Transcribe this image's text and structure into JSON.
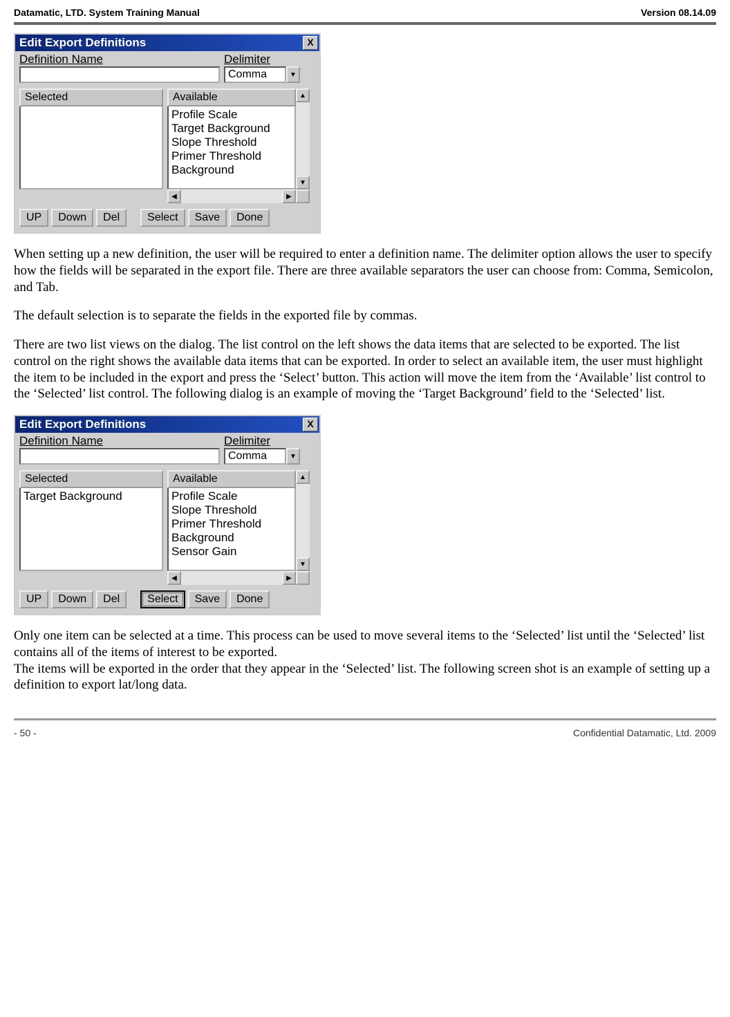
{
  "header": {
    "left": "Datamatic, LTD. System Training  Manual",
    "right": "Version 08.14.09"
  },
  "dialog1": {
    "title": "Edit Export Definitions",
    "close": "X",
    "defname_label": "Definition Name",
    "defname_value": "",
    "delimiter_label": "Delimiter",
    "delimiter_value": "Comma",
    "selected_header": "Selected",
    "available_header": "Available",
    "selected_items": [],
    "available_items": [
      "Profile Scale",
      "Target Background",
      "Slope Threshold",
      "Primer Threshold",
      "Background"
    ],
    "buttons": {
      "up": "UP",
      "down": "Down",
      "del": "Del",
      "select": "Select",
      "save": "Save",
      "done": "Done"
    }
  },
  "para1": "When setting up a new definition, the user will be required to enter a definition name.  The delimiter option allows the user to specify how the fields will be separated in the export file.  There are three available separators the user can choose from: Comma, Semicolon, and Tab.",
  "para2": "The default selection is to separate the fields in the exported file by commas.",
  "para3": "There are two list views on the dialog.  The list control on the left shows the data items that are selected to be exported.  The list control on the right shows the available data items that can be exported.  In order to select an available item, the user must highlight the item to be included in the export and press the ‘Select’ button.  This action will move the item from the ‘Available’ list control to the ‘Selected’ list control.  The following dialog is an example of moving the ‘Target Background’ field to the ‘Selected’ list.",
  "dialog2": {
    "title": "Edit Export Definitions",
    "close": "X",
    "defname_label": "Definition Name",
    "defname_value": "",
    "delimiter_label": "Delimiter",
    "delimiter_value": "Comma",
    "selected_header": "Selected",
    "available_header": "Available",
    "selected_items": [
      "Target Background"
    ],
    "available_items": [
      "Profile Scale",
      "Slope Threshold",
      "Primer Threshold",
      "Background",
      "Sensor Gain"
    ],
    "buttons": {
      "up": "UP",
      "down": "Down",
      "del": "Del",
      "select": "Select",
      "save": "Save",
      "done": "Done"
    }
  },
  "para4": "Only one item can be selected at a time.  This process can be used to move several items to the ‘Selected’ list until the ‘Selected’ list contains all of the items of interest to be exported.",
  "para5": "The items will be exported in the order that they appear in the ‘Selected’ list.  The following screen shot is an example of setting up a definition to export lat/long data.",
  "footer": {
    "left": "- 50 -",
    "right": "Confidential Datamatic, Ltd. 2009"
  }
}
